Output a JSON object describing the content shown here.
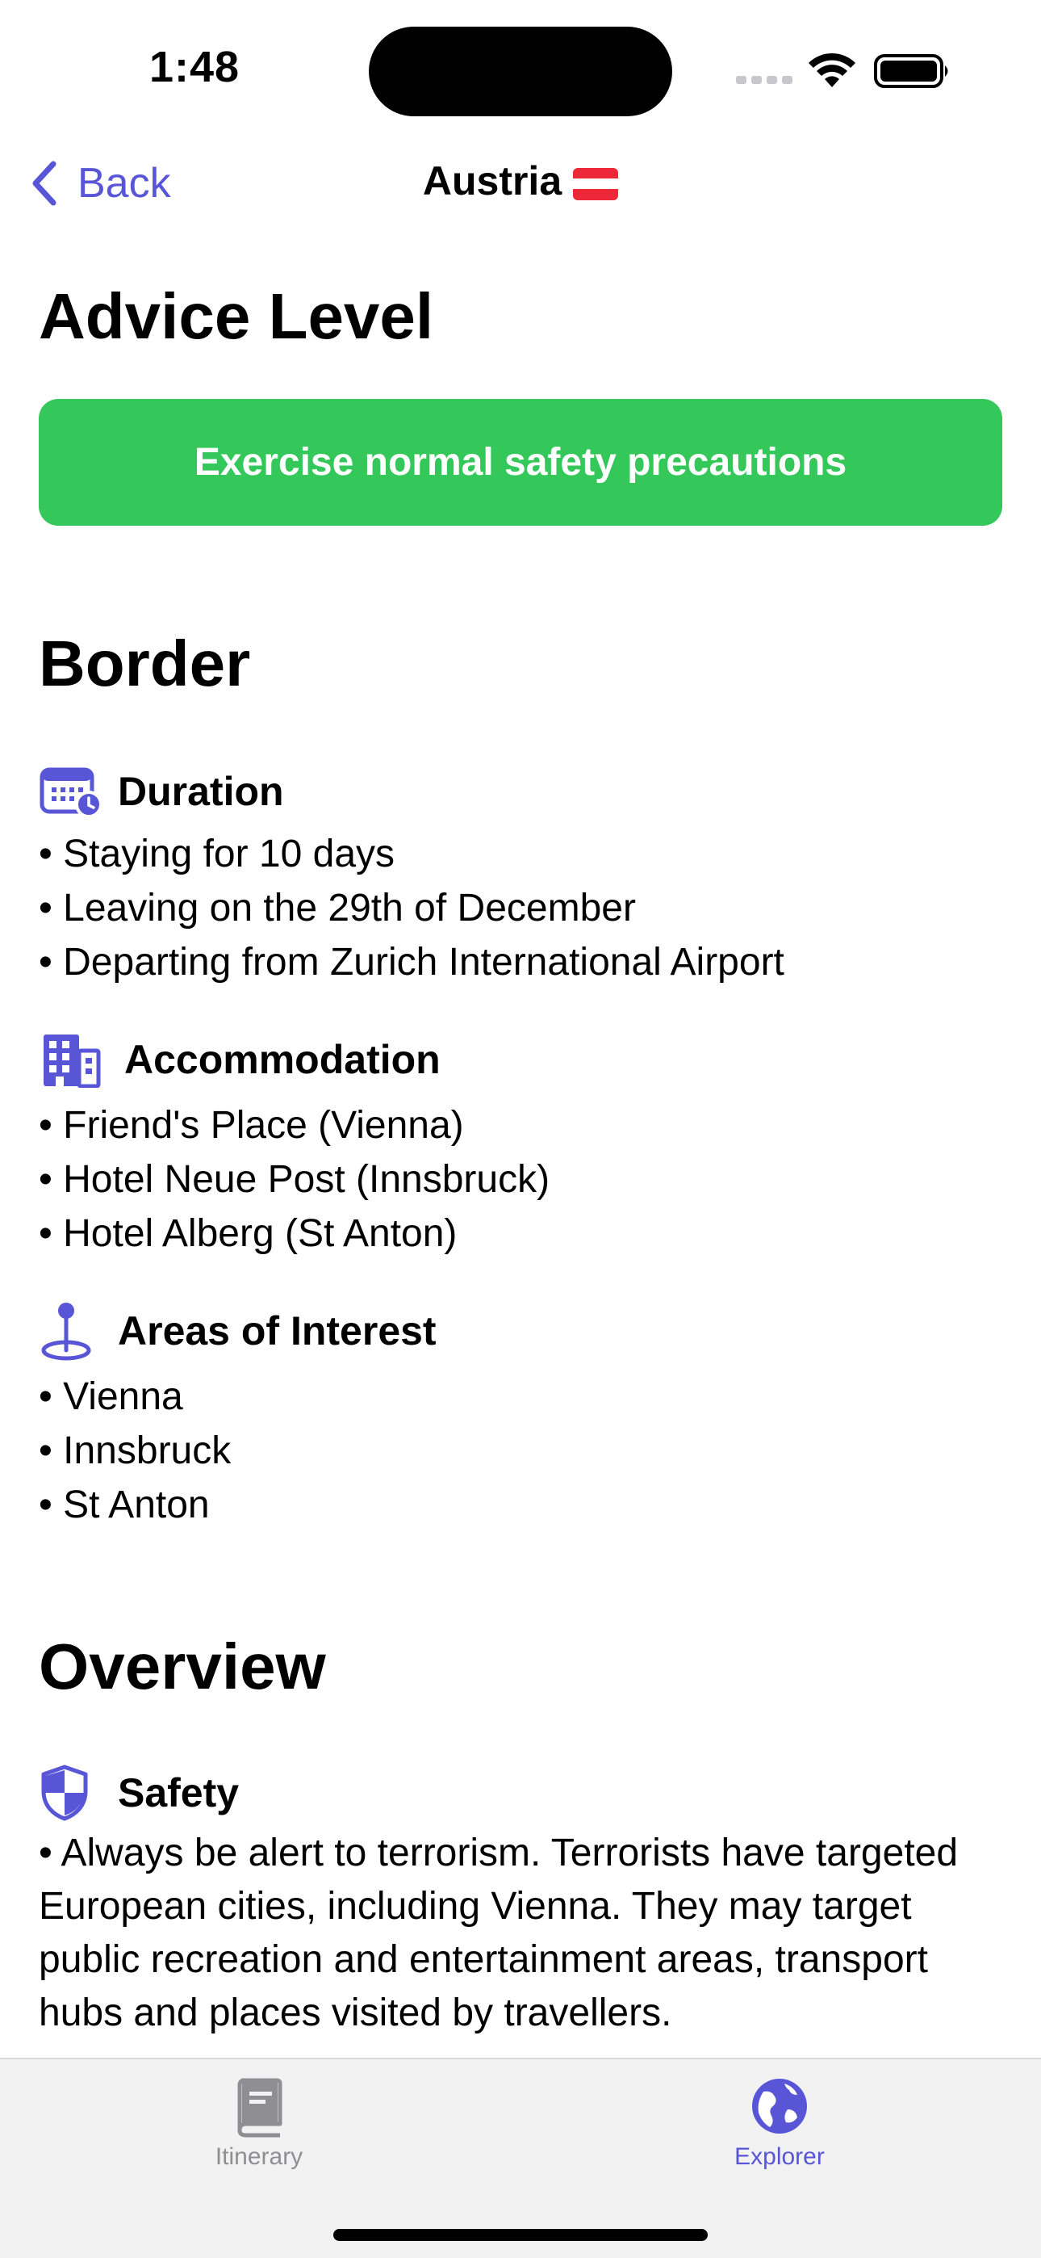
{
  "status_bar": {
    "time": "1:48"
  },
  "nav": {
    "back_label": "Back",
    "title": "Austria",
    "flag_colors": [
      "#ed2939",
      "#ffffff",
      "#ed2939"
    ]
  },
  "advice": {
    "heading": "Advice Level",
    "level_label": "Exercise normal safety precautions",
    "level_color": "#34c759"
  },
  "border": {
    "heading": "Border",
    "duration": {
      "icon": "calendar-clock-icon",
      "title": "Duration",
      "items": [
        "• Staying for 10 days",
        "• Leaving on the 29th of December",
        "• Departing from Zurich International Airport"
      ]
    },
    "accommodation": {
      "icon": "building-icon",
      "title": "Accommodation",
      "items": [
        "• Friend's Place (Vienna)",
        "• Hotel Neue Post (Innsbruck)",
        "• Hotel Alberg (St Anton)"
      ]
    },
    "areas": {
      "icon": "map-pin-icon",
      "title": "Areas of Interest",
      "items": [
        "• Vienna",
        "• Innsbruck",
        "• St Anton"
      ]
    }
  },
  "overview": {
    "heading": "Overview",
    "safety": {
      "icon": "shield-icon",
      "title": "Safety",
      "text": "• Always be alert to terrorism. Terrorists have targeted European cities, including Vienna. They may target public recreation and entertainment areas, transport hubs and places visited by travellers."
    }
  },
  "tab_bar": {
    "tabs": [
      {
        "label": "Itinerary",
        "icon": "book-icon",
        "selected": false
      },
      {
        "label": "Explorer",
        "icon": "globe-icon",
        "selected": true
      }
    ],
    "accent": "#5856d6",
    "inactive": "#8e8e93"
  }
}
